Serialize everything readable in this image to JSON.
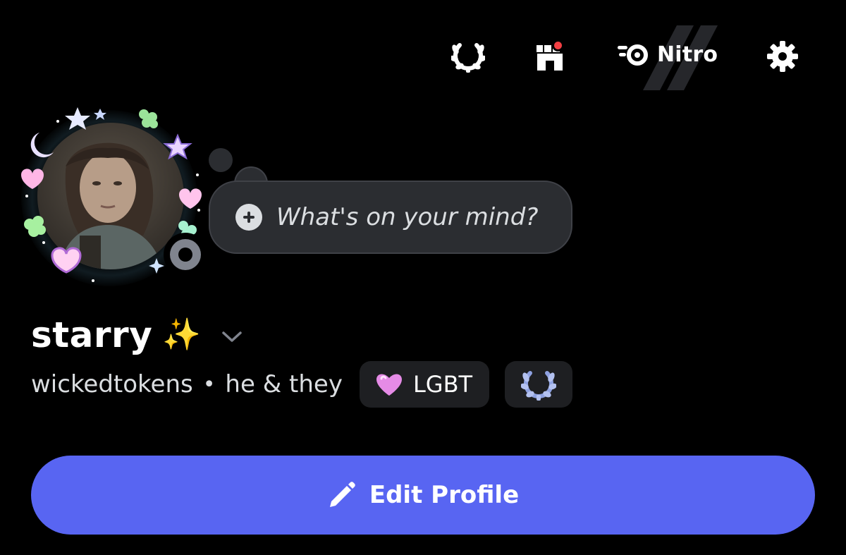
{
  "header": {
    "quests_icon": "laurel-wreath-icon",
    "shop_icon": "shop-icon",
    "shop_has_notification": true,
    "nitro_icon": "nitro-logo-icon",
    "nitro_label": "Nitro",
    "settings_icon": "gear-icon"
  },
  "profile": {
    "avatar_icon": "avatar-photo",
    "status_icon": "offline-status-icon",
    "custom_status_placeholder": "What's on your mind?",
    "custom_status_add_icon": "plus-circle-icon",
    "display_name": "starry",
    "display_name_emoji": "✨",
    "display_name_menu_icon": "chevron-down-icon",
    "username": "wickedtokens",
    "separator": "•",
    "pronouns": "he & they",
    "tag": {
      "icon": "pink-heart-icon",
      "label": "LGBT"
    },
    "badge_icon": "laurel-wreath-badge-icon"
  },
  "actions": {
    "edit_icon": "pencil-icon",
    "edit_label": "Edit Profile"
  },
  "colors": {
    "background": "#000000",
    "accent": "#5865f2",
    "bubble": "#2b2d31",
    "chip": "#1e1f22",
    "notification": "#f23f43",
    "muted_text": "#dbdee1"
  }
}
